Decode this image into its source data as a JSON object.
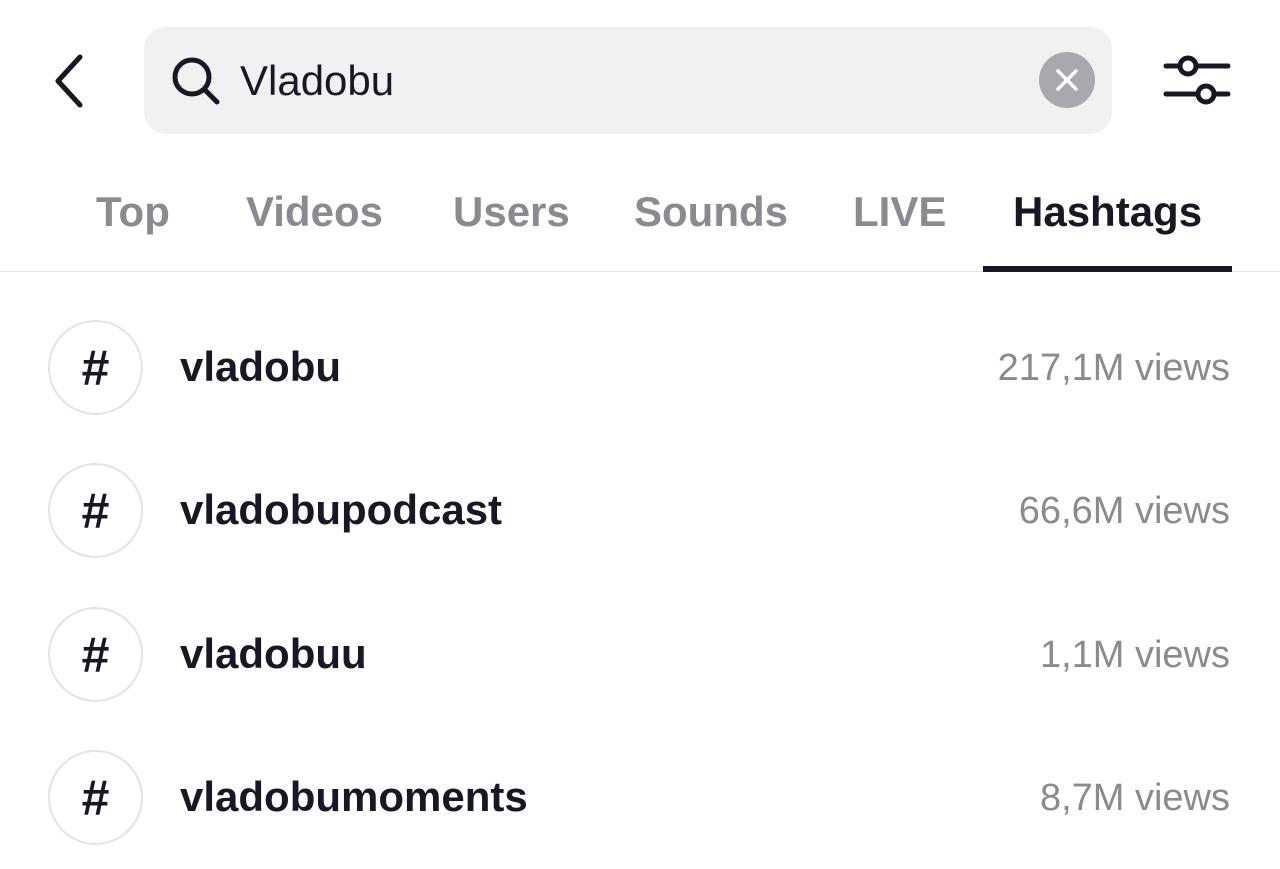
{
  "search": {
    "query": "Vladobu",
    "back_icon": "chevron-left-icon",
    "search_icon": "magnifier-icon",
    "clear_icon": "close-icon",
    "filter_icon": "sliders-icon"
  },
  "tabs": [
    {
      "label": "Top",
      "active": false
    },
    {
      "label": "Videos",
      "active": false
    },
    {
      "label": "Users",
      "active": false
    },
    {
      "label": "Sounds",
      "active": false
    },
    {
      "label": "LIVE",
      "active": false
    },
    {
      "label": "Hashtags",
      "active": true
    }
  ],
  "hashtags": [
    {
      "symbol": "#",
      "name": "vladobu",
      "views": "217,1M views"
    },
    {
      "symbol": "#",
      "name": "vladobupodcast",
      "views": "66,6M views"
    },
    {
      "symbol": "#",
      "name": "vladobuu",
      "views": "1,1M views"
    },
    {
      "symbol": "#",
      "name": "vladobumoments",
      "views": "8,7M views"
    }
  ],
  "colors": {
    "text_primary": "#161823",
    "text_secondary": "#8a8b91",
    "search_bg": "#f1f1f2",
    "clear_bg": "#a9a9ad",
    "divider": "#e3e3e4"
  }
}
